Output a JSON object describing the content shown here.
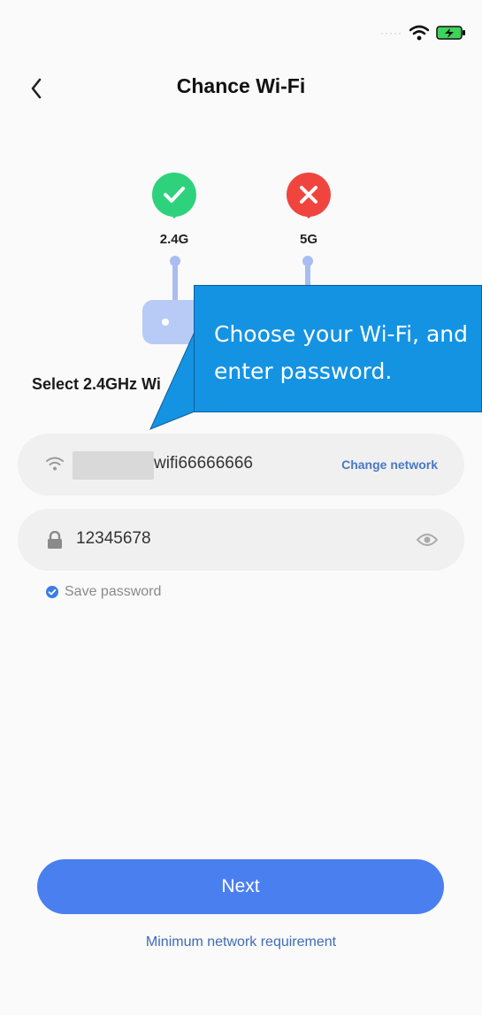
{
  "header": {
    "title": "Chance Wi-Fi"
  },
  "bands": {
    "band_24": "2.4G",
    "band_5": "5G"
  },
  "section_label": "Select 2.4GHz Wi",
  "wifi_field": {
    "ssid": "wifi66666666",
    "change_label": "Change network"
  },
  "password_field": {
    "value": "12345678"
  },
  "save_password": {
    "label": "Save password",
    "checked": true
  },
  "next_button": {
    "label": "Next"
  },
  "min_requirement_link": "Minimum network requirement",
  "tooltip": {
    "text": "Choose your Wi-Fi, and enter password."
  },
  "colors": {
    "accent": "#4a7ff0",
    "ok": "#2fd27c",
    "error": "#f0453f",
    "tooltip": "#1493e3",
    "link": "#4a78c4"
  }
}
